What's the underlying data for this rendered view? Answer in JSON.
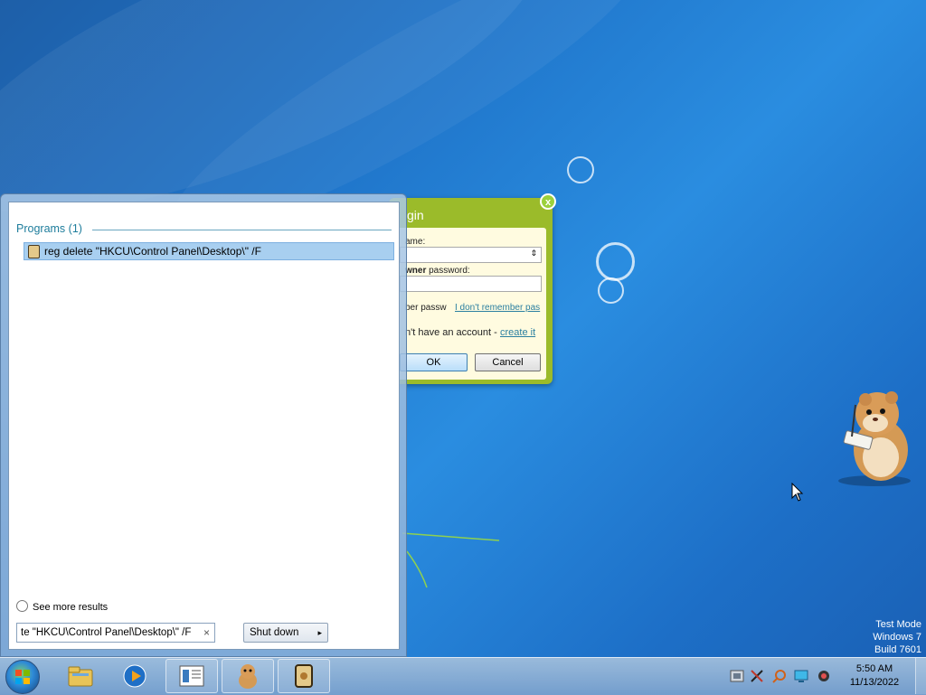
{
  "desktop": {
    "watermark": [
      "Test Mode",
      "Windows 7",
      "Build 7601"
    ]
  },
  "login_dialog": {
    "title": "gin",
    "username_label": "ame:",
    "password_label_bold": "wner",
    "password_label_rest": " password:",
    "remember_label": "ber passw",
    "forgot_link": "I don't remember pas",
    "account_text": "n't have an account - ",
    "create_link": "create it",
    "ok_label": "OK",
    "cancel_label": "Cancel",
    "close_glyph": "x"
  },
  "start_menu": {
    "section_title": "Programs (1)",
    "result_label": "reg delete \"HKCU\\Control Panel\\Desktop\\\" /F",
    "see_more": "See more results",
    "search_value": "te \"HKCU\\Control Panel\\Desktop\\\" /F",
    "clear_glyph": "×",
    "shutdown_label": "Shut down",
    "shutdown_arrow": "▸"
  },
  "taskbar": {
    "pinned": [
      "windows-explorer-icon",
      "media-player-icon",
      "notepad-window-icon",
      "hamster-app-icon",
      "script-app-icon"
    ],
    "tray_icons": [
      "network-icon",
      "tools-icon",
      "search-icon",
      "monitor-icon",
      "webcam-icon"
    ],
    "time": "5:50 AM",
    "date": "11/13/2022"
  }
}
